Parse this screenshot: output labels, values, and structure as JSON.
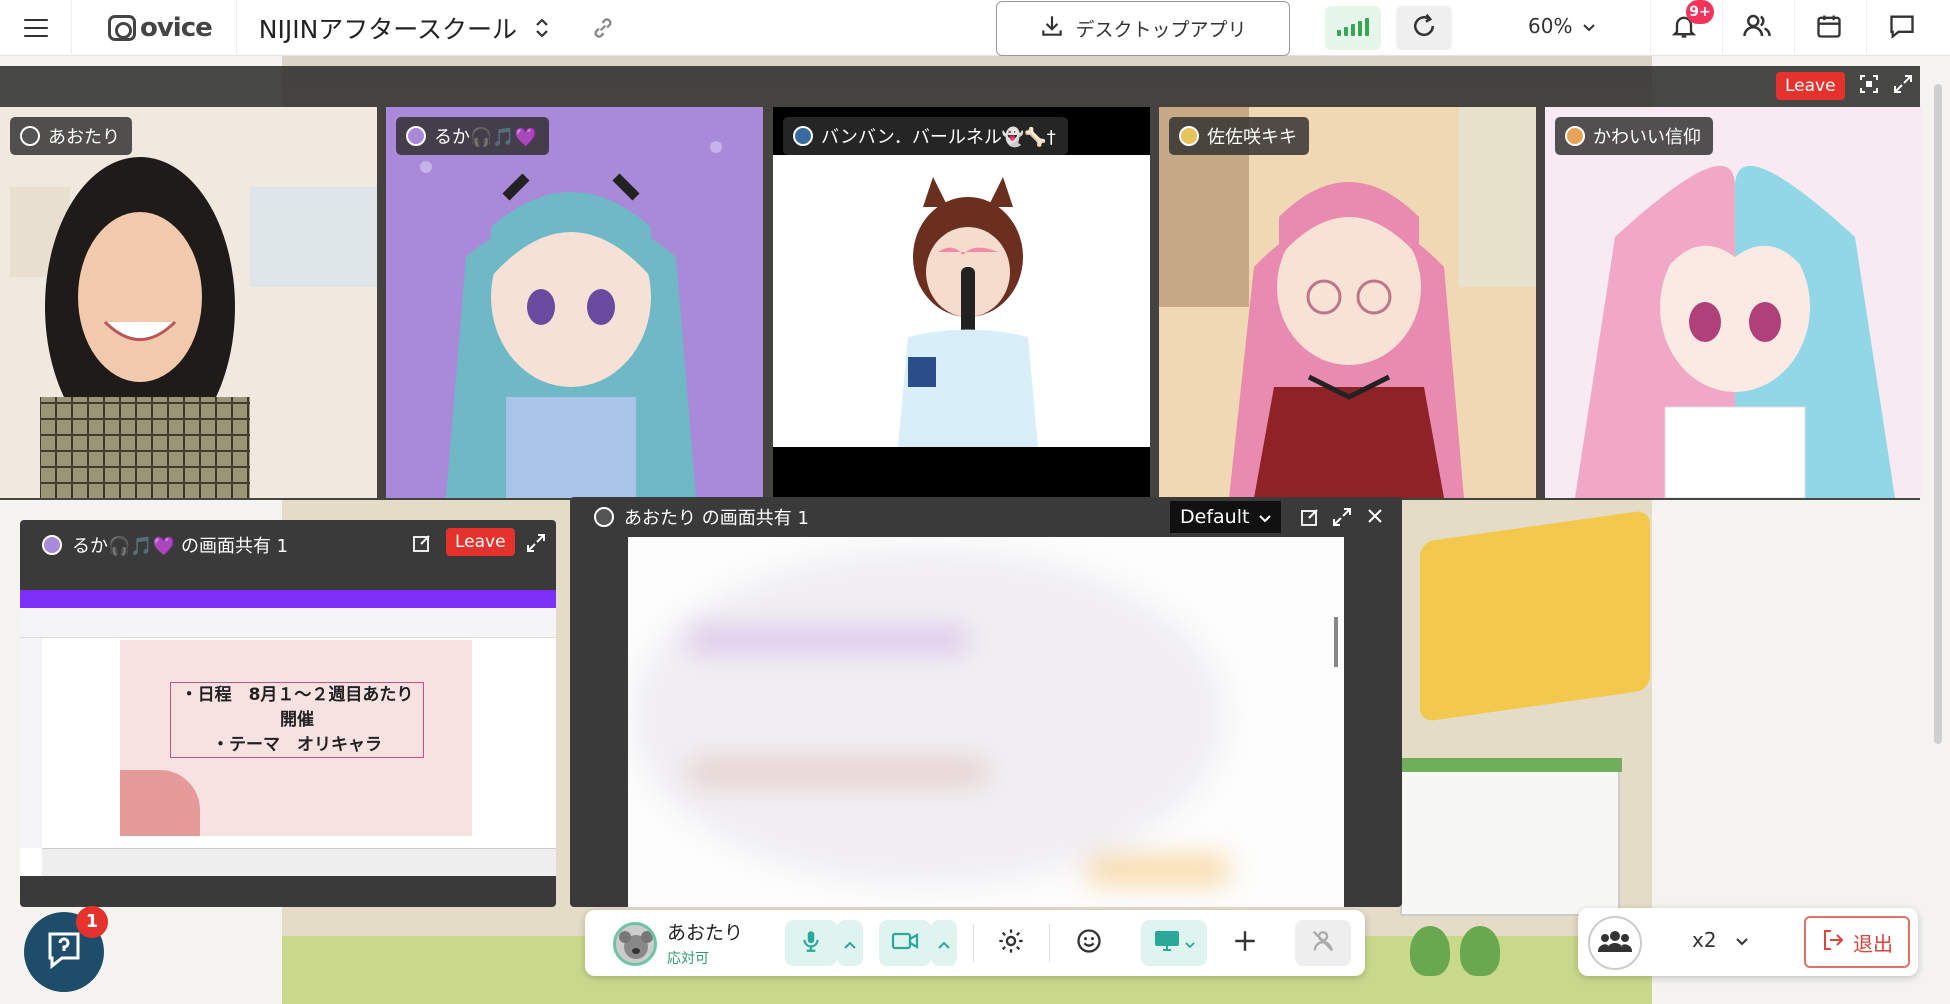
{
  "topbar": {
    "logo_text": "ovice",
    "space_name": "NIJINアフタースクール",
    "desktop_app_label": "デスクトップアプリ",
    "zoom_level": "60%",
    "notification_badge": "9+"
  },
  "video_strip": {
    "leave_label": "Leave",
    "tiles": [
      {
        "name": "あおたり",
        "bg": "#efe6da"
      },
      {
        "name": "るか🎧🎵💜",
        "bg": "#a98ad9"
      },
      {
        "name": "バンバン．バールネル👻🦴†",
        "bg": "#ffffff"
      },
      {
        "name": "佐佐咲キキ",
        "bg": "#f3d8b4"
      },
      {
        "name": "かわいい信仰",
        "bg": "#f6e3ee"
      }
    ]
  },
  "share_left": {
    "title": "るか🎧🎵💜 の画面共有 1",
    "leave_label": "Leave",
    "slide_lines": [
      "・日程　8月１～２週目あたり",
      "開催",
      "・テーマ　オリキャラ"
    ]
  },
  "share_right": {
    "title": "あおたり の画面共有 1",
    "quality_label": "Default"
  },
  "bottombar": {
    "user_name": "あおたり",
    "user_status": "応対可"
  },
  "group_panel": {
    "speed_label": "x2",
    "exit_label": "退出"
  },
  "help": {
    "badge": "1"
  }
}
